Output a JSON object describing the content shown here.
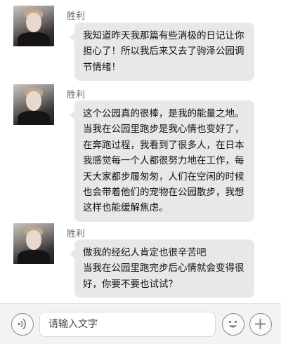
{
  "messages": [
    {
      "sender": "胜利",
      "lines": [
        "我知道昨天我那篇有些消极的日记让你",
        "担心了！所以我后来又去了驹泽公园调",
        "节情绪！"
      ]
    },
    {
      "sender": "胜利",
      "lines": [
        "这个公园真的很棒，是我的能量之地。",
        "当我在公园里跑步是我心情也变好了，",
        "在奔跑过程，我看到了很多人，在日本",
        "我感觉每一个人都很努力地在工作，每",
        "天大家都步履匆匆，人们在空闲的时候",
        "也会带着他们的宠物在公园散步，我想",
        "这样也能缓解焦虑。"
      ]
    },
    {
      "sender": "胜利",
      "lines": [
        "做我的经纪人肯定也很辛苦吧",
        "当我在公园里跑完步后心情就会变得很",
        "好，你要不要也试试？"
      ]
    }
  ],
  "input_bar": {
    "placeholder": "请输入文字",
    "voice_icon": "voice-icon",
    "emoji_icon": "emoji-icon",
    "plus_icon": "plus-icon"
  },
  "colors": {
    "bubble": "#e8e8e8",
    "bar": "#f3f3f3",
    "name": "#666666"
  }
}
